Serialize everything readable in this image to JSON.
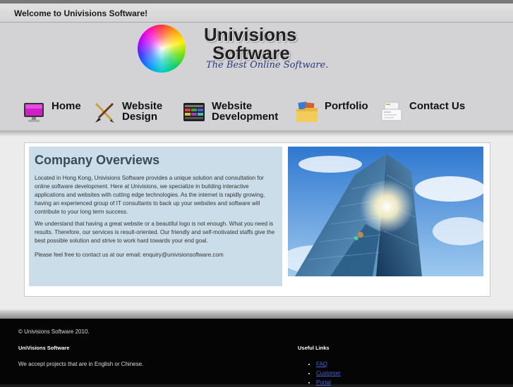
{
  "topbar": {
    "welcome": "Welcome to Univisions Software!"
  },
  "logo": {
    "line1": "Univisions",
    "line2": "Software",
    "tagline": "The Best Online Software."
  },
  "nav": [
    {
      "line1": "Home",
      "line2": "",
      "icon": "monitor-icon"
    },
    {
      "line1": "Website",
      "line2": "Design",
      "icon": "paintbrush-pencil-icon"
    },
    {
      "line1": "Website",
      "line2": "Development",
      "icon": "code-window-icon"
    },
    {
      "line1": "Portfolio",
      "line2": "",
      "icon": "folder-photos-icon"
    },
    {
      "line1": "Contact Us",
      "line2": "",
      "icon": "address-card-icon"
    }
  ],
  "overview": {
    "title": "Company Overviews",
    "paragraphs": [
      "Located in Hong Kong, Univisions Software provides a unique solution and consultation for online software development. Here at Univisions, we specialize in building interactive applications and websites with cutting edge technologies. As the internet is rapidly growing, having an experienced group of IT consultants to back up your websites and software will contribute to your long term success.",
      "We understand that having a great website or a beautiful logo is not enough. What you need is results. Therefore, our services is result-oriented. Our friendly and self-motivated staffs give the best possible solution and strive to work hard towards your end goal.",
      "Please feel free to contact us at our email: enquiry@univisionsoftware.com"
    ]
  },
  "footer": {
    "copyright": "© Univisions Software 2010.",
    "company_title": "UniVisions Software",
    "company_text": "We accept projects that are in English or Chinese.",
    "links_title": "Useful Links",
    "links": [
      "FAQ",
      "Customer",
      "Portal"
    ]
  },
  "colors": {
    "header_bg": "#d3d3d6",
    "overview_bg": "#cbdde9",
    "footer_bg": "#050505",
    "link": "#4a62d8"
  }
}
